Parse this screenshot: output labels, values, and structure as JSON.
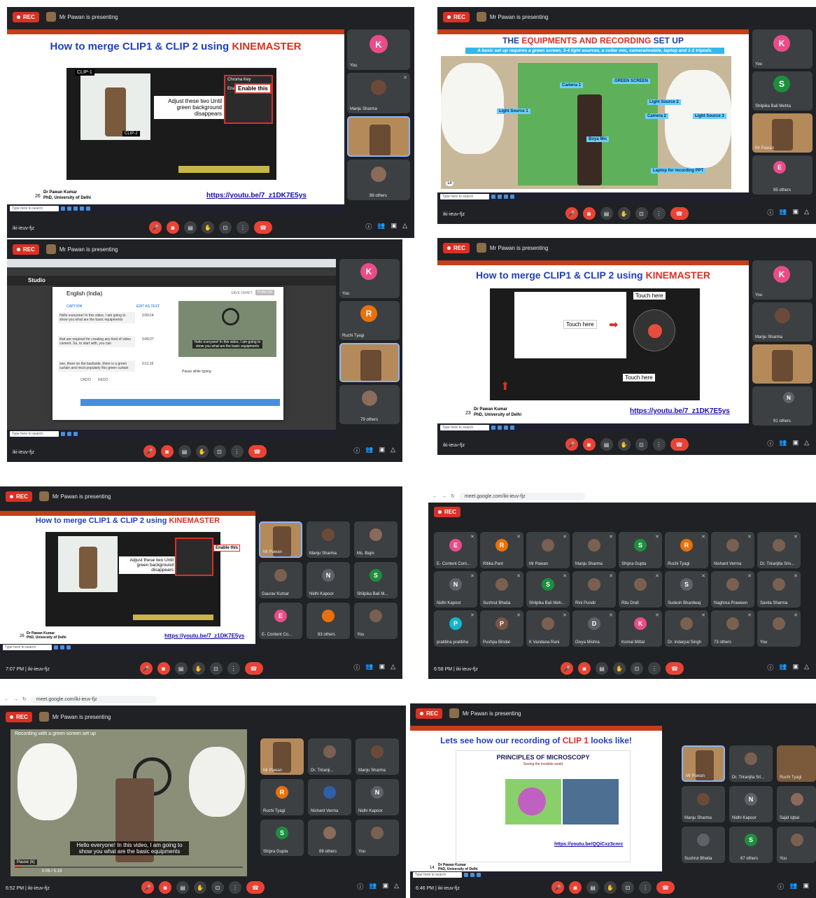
{
  "common": {
    "rec_label": "REC",
    "presenting": "Mr Pawan is presenting",
    "meeting_code": "iki-ieuv-fjz",
    "search_placeholder": "Type here to search",
    "browser_url": "meet.google.com/iki-ieuv-fjz",
    "colors": {
      "meet_bg": "#202124",
      "tile_bg": "#3c4043",
      "rec_red": "#d93025",
      "end_call": "#ea4335",
      "slide_title_blue": "#1f3fbf",
      "kinemaster_red": "#d93025"
    }
  },
  "p1": {
    "slide_title_pre": "How to merge ",
    "slide_title_bold": "CLIP1 & CLIP 2",
    "slide_title_mid": " using ",
    "slide_title_red": "KINEMASTER",
    "clip1": "CLIP-1",
    "clip2": "CLIP-2",
    "chroma": "Chroma Key",
    "enable": "Enable",
    "enable_this": "Enable this",
    "adjust": "Adjust these two Until green background disappears",
    "slide_num": "26",
    "presenter": "Dr Pawan Kumar",
    "affil": "PhD, University of Delhi",
    "link": "https://youtu.be/7_z1DK7E5ys",
    "tiles": [
      {
        "letter": "K",
        "name": "You",
        "color": "#ea4c89"
      },
      {
        "letter": "",
        "name": "Manju Sharma",
        "color": ""
      },
      {
        "letter": "",
        "name": "",
        "color": ""
      },
      {
        "letter": "",
        "name": "88 others",
        "color": ""
      }
    ]
  },
  "p2": {
    "slide_title_pre": "THE ",
    "slide_title_red": "EQUIPMENTS AND RECORDING",
    "slide_title_post": " SET UP",
    "subtitle": "A basic set up requires a green screen, 3-4 light sources, a collar mic, camera/mobile, laptop and 1-2 tripods.",
    "labels": [
      "Camera 1",
      "GREEN SCREEN",
      "Light Source 1",
      "Light Source 2",
      "Camera 2",
      "Light Source 3",
      "Boya Mic",
      "Laptop for recording PPT"
    ],
    "slide_num": "18",
    "tiles": [
      {
        "letter": "K",
        "name": "You",
        "color": "#ea4c89"
      },
      {
        "letter": "S",
        "name": "Shilpika Bali Mehta",
        "color": "#1e8e3e"
      },
      {
        "letter": "",
        "name": "Mr Pawan",
        "color": ""
      },
      {
        "letter": "E",
        "name": "95 others",
        "color": "#ea4c89"
      }
    ]
  },
  "p3": {
    "studio": "Studio",
    "dialog_title": "English (India)",
    "save_draft": "SAVE DRAFT",
    "publish": "PUBLISH",
    "caption_btn": "CAPTION",
    "edit_as_text": "EDIT AS TEXT",
    "lines": [
      "Hello everyone! In this video, I am going to show you what are the basic equipments",
      "that are required for creating any kind of video content. So, to start with, you can",
      "see, there on the backside, there is a green curtain and most popularly this green curtain"
    ],
    "times": [
      "0:00:14",
      "0:00:27",
      "0:11:16"
    ],
    "overlay": "Hello everyone! In this video, I am going to show you what are the basic equipments",
    "pause_typing": "Pause while typing",
    "undo": "UNDO",
    "redo": "REDO",
    "tiles": [
      {
        "letter": "K",
        "name": "You",
        "color": "#ea4c89"
      },
      {
        "letter": "R",
        "name": "Ruchi Tyagi",
        "color": "#e8710a"
      },
      {
        "letter": "",
        "name": "",
        "color": ""
      },
      {
        "letter": "",
        "name": "79 others",
        "color": ""
      }
    ]
  },
  "p4": {
    "slide_title_pre": "How to merge ",
    "slide_title_bold": "CLIP1 & CLIP 2",
    "slide_title_mid": " using ",
    "slide_title_red": "KINEMASTER",
    "touch1": "Touch here",
    "touch2": "Touch here",
    "touch3": "Touch here",
    "slide_num": "23",
    "presenter": "Dr Pawan Kumar",
    "affil": "PhD, University of Delhi",
    "link": "https://youtu.be/7_z1DK7E5ys",
    "tiles": [
      {
        "letter": "K",
        "name": "You",
        "color": "#ea4c89"
      },
      {
        "letter": "",
        "name": "Manju Sharma",
        "color": ""
      },
      {
        "letter": "",
        "name": "",
        "color": ""
      },
      {
        "letter": "N",
        "name": "91 others",
        "color": "#5f6368"
      }
    ]
  },
  "p5": {
    "slide_title_pre": "How to merge ",
    "slide_title_bold": "CLIP1 & CLIP 2",
    "slide_title_mid": " using ",
    "slide_title_red": "KINEMASTER",
    "adjust": "Adjust these two Until green background disappears",
    "enable_this": "Enable this",
    "presenter": "Dr Pawan Kumar",
    "affil": "PhD, University of Delhi",
    "slide_num": "26",
    "link": "https://youtu.be/7_z1DK7E5ys",
    "time": "7:07 PM",
    "tiles": [
      {
        "letter": "",
        "name": "Mr Pawan",
        "color": ""
      },
      {
        "letter": "",
        "name": "Manju Sharma",
        "color": ""
      },
      {
        "letter": "",
        "name": "Ms. Bajni",
        "color": ""
      },
      {
        "letter": "",
        "name": "Gaurav Kumar",
        "color": ""
      },
      {
        "letter": "N",
        "name": "Nidhi Kapoor",
        "color": "#5f6368"
      },
      {
        "letter": "S",
        "name": "Shilpika Bali M...",
        "color": "#1e8e3e"
      },
      {
        "letter": "E",
        "name": "E- Content Co...",
        "color": "#ea4c89"
      },
      {
        "letter": "",
        "name": "83 others",
        "color": ""
      },
      {
        "letter": "",
        "name": "You",
        "color": ""
      }
    ]
  },
  "p6": {
    "url": "meet.google.com/iki-ieuv-fjz",
    "time": "6:58 PM",
    "tiles": [
      {
        "letter": "E",
        "name": "E- Content Com...",
        "color": "#ea4c89"
      },
      {
        "letter": "R",
        "name": "Ritika Pant",
        "color": "#e8710a"
      },
      {
        "letter": "",
        "name": "Mr Pawan",
        "color": ""
      },
      {
        "letter": "",
        "name": "Manju Sharma",
        "color": ""
      },
      {
        "letter": "S",
        "name": "Shipra Gupta",
        "color": "#1e8e3e"
      },
      {
        "letter": "R",
        "name": "Ruchi Tyagi",
        "color": "#e8710a"
      },
      {
        "letter": "",
        "name": "Nishant Verma",
        "color": ""
      },
      {
        "letter": "",
        "name": "Dr. Triranjita Sriv...",
        "color": ""
      },
      {
        "letter": "N",
        "name": "Nidhi Kapoor",
        "color": "#5f6368"
      },
      {
        "letter": "",
        "name": "Sushrut Bhatia",
        "color": ""
      },
      {
        "letter": "S",
        "name": "Shilpika Bali Meh...",
        "color": "#1e8e3e"
      },
      {
        "letter": "",
        "name": "Rini Pundir",
        "color": ""
      },
      {
        "letter": "",
        "name": "Ritu Drall",
        "color": ""
      },
      {
        "letter": "S",
        "name": "Sudesh Bhardwaj",
        "color": "#5f6368"
      },
      {
        "letter": "",
        "name": "Naghma Praween",
        "color": ""
      },
      {
        "letter": "",
        "name": "Savita Sharma",
        "color": ""
      },
      {
        "letter": "P",
        "name": "pratibha pratibha",
        "color": "#12b5cb"
      },
      {
        "letter": "P",
        "name": "Pushpa Bindal",
        "color": "#795548"
      },
      {
        "letter": "",
        "name": "K Vandana Rani",
        "color": ""
      },
      {
        "letter": "D",
        "name": "Divya Mishra",
        "color": "#5f6368"
      },
      {
        "letter": "K",
        "name": "Komal Mittal",
        "color": "#ea4c89"
      },
      {
        "letter": "",
        "name": "Dr. Indarpal Singh",
        "color": ""
      },
      {
        "letter": "",
        "name": "73 others",
        "color": ""
      },
      {
        "letter": "",
        "name": "You",
        "color": ""
      }
    ]
  },
  "p7": {
    "url": "meet.google.com/iki-ieuv-fjz",
    "video_title": "Recording with a green screen set up",
    "caption": "Hello everyone! In this video, I am going to show you what are the basic equipments",
    "pause": "Pause (k)",
    "progress": "0:06 / 5:19",
    "time": "6:52 PM",
    "tiles": [
      {
        "letter": "",
        "name": "Mr Pawan",
        "color": ""
      },
      {
        "letter": "",
        "name": "Dr. Triranji...",
        "color": ""
      },
      {
        "letter": "",
        "name": "Manju Sharma",
        "color": ""
      },
      {
        "letter": "R",
        "name": "Ruchi Tyagi",
        "color": "#e8710a"
      },
      {
        "letter": "",
        "name": "Nishant Verma",
        "color": ""
      },
      {
        "letter": "N",
        "name": "Nidhi Kapoor",
        "color": "#5f6368"
      },
      {
        "letter": "S",
        "name": "Shipra Gupta",
        "color": "#1e8e3e"
      },
      {
        "letter": "",
        "name": "89 others",
        "color": ""
      },
      {
        "letter": "",
        "name": "You",
        "color": ""
      }
    ]
  },
  "p8": {
    "slide_title_pre": "Lets see how our recording of ",
    "slide_title_bold": "CLIP 1",
    "slide_title_post": " looks like!",
    "principles": "PRINCIPLES OF MICROSCOPY",
    "principles_sub": "Seeing the invisible world",
    "presenter": "Dr Pawan Kumar",
    "affil": "PhD, University of Delhi",
    "slide_num": "14",
    "link": "https://youtu.be/QQiCxz3cnrc",
    "time": "6:46 PM",
    "tiles": [
      {
        "letter": "",
        "name": "Mr Pawan",
        "color": ""
      },
      {
        "letter": "",
        "name": "Dr. Triranjita Sri...",
        "color": ""
      },
      {
        "letter": "",
        "name": "Ruchi Tyagi",
        "color": ""
      },
      {
        "letter": "",
        "name": "Manju Sharma",
        "color": ""
      },
      {
        "letter": "N",
        "name": "Nidhi Kapoor",
        "color": "#5f6368"
      },
      {
        "letter": "",
        "name": "Sajid Iqbal",
        "color": ""
      },
      {
        "letter": "",
        "name": "Sushrut Bhatia",
        "color": ""
      },
      {
        "letter": "S",
        "name": "67 others",
        "color": "#1e8e3e"
      },
      {
        "letter": "",
        "name": "You",
        "color": ""
      }
    ]
  }
}
